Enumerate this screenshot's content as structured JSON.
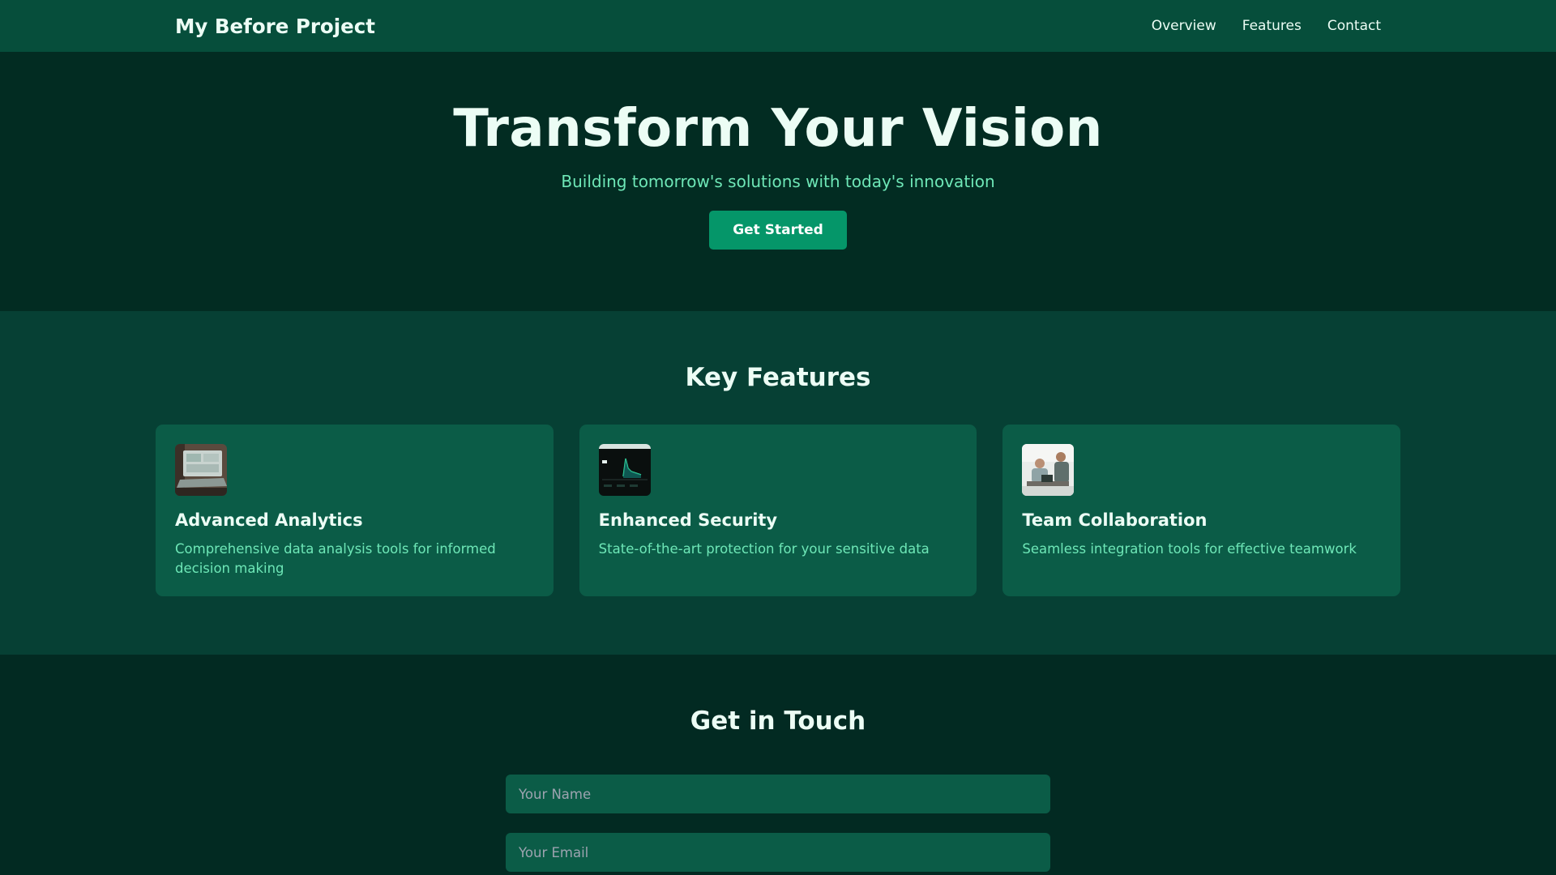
{
  "nav": {
    "brand": "My Before Project",
    "links": [
      "Overview",
      "Features",
      "Contact"
    ]
  },
  "hero": {
    "title": "Transform Your Vision",
    "subtitle": "Building tomorrow's solutions with today's innovation",
    "cta": "Get Started"
  },
  "features": {
    "title": "Key Features",
    "cards": [
      {
        "title": "Advanced Analytics",
        "desc": "Comprehensive data analysis tools for informed decision making",
        "image": "laptop-analytics-image"
      },
      {
        "title": "Enhanced Security",
        "desc": "State-of-the-art protection for your sensitive data",
        "image": "security-dashboard-image"
      },
      {
        "title": "Team Collaboration",
        "desc": "Seamless integration tools for effective teamwork",
        "image": "team-meeting-image"
      }
    ]
  },
  "contact": {
    "title": "Get in Touch",
    "name_placeholder": "Your Name",
    "email_placeholder": "Your Email"
  },
  "colors": {
    "nav_bg": "#064e3b",
    "hero_bg": "#022c22",
    "accent": "#059669",
    "muted_text": "#6ee7b7",
    "card_bg": "#0b5c47"
  }
}
